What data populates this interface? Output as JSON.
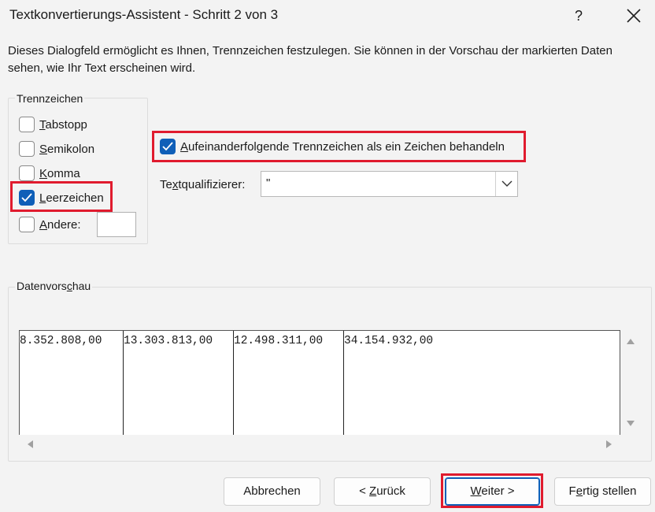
{
  "window": {
    "title": "Textkonvertierungs-Assistent - Schritt 2 von 3",
    "help_label": "?",
    "description": "Dieses Dialogfeld ermöglicht es Ihnen, Trennzeichen festzulegen. Sie können in der Vorschau der markierten Daten sehen, wie Ihr Text erscheinen wird."
  },
  "delimiters": {
    "group_label": "Trennzeichen",
    "items": [
      {
        "access_key": "T",
        "rest": "abstopp",
        "checked": false
      },
      {
        "access_key": "S",
        "rest": "emikolon",
        "checked": false
      },
      {
        "access_key": "K",
        "rest": "omma",
        "checked": false
      },
      {
        "access_key": "L",
        "rest": "eerzeichen",
        "checked": true
      },
      {
        "access_key": "A",
        "rest": "ndere:",
        "checked": false
      }
    ],
    "other_value": ""
  },
  "consecutive": {
    "access_key": "A",
    "rest": "ufeinanderfolgende Trennzeichen als ein Zeichen behandeln",
    "checked": true
  },
  "qualifier": {
    "label_pre": "Te",
    "access_key": "x",
    "label_post": "tqualifizierer:",
    "value": "\""
  },
  "preview": {
    "label_pre": "Datenvors",
    "access_key": "c",
    "label_post": "hau",
    "columns": [
      "8.352.808,00",
      "13.303.813,00",
      "12.498.311,00",
      "34.154.932,00"
    ]
  },
  "buttons": {
    "cancel": "Abbrechen",
    "back_pre": "< ",
    "back_key": "Z",
    "back_post": "urück",
    "next_key": "W",
    "next_post": "eiter >",
    "finish_pre": "F",
    "finish_key": "e",
    "finish_post": "rtig stellen"
  },
  "colors": {
    "accent": "#0f5fb8",
    "highlight": "#e01b2e"
  }
}
